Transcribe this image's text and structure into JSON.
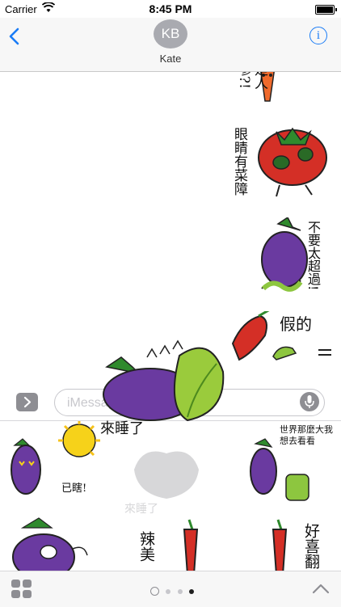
{
  "status_bar": {
    "carrier": "Carrier",
    "time": "8:45 PM"
  },
  "navbar": {
    "avatar_initials": "KB",
    "contact_name": "Kate"
  },
  "transcript": {
    "stickers": [
      {
        "name": "carrot",
        "caption": "是人參?!"
      },
      {
        "name": "tomato",
        "caption": "眼睛有菜障"
      },
      {
        "name": "eggplant-worm",
        "caption": "不要太超過!"
      },
      {
        "name": "chili",
        "caption": "假的"
      }
    ]
  },
  "compose": {
    "placeholder": "iMessage"
  },
  "drag_sticker": {
    "caption": "來睡了"
  },
  "drawer": {
    "stickers": [
      {
        "name": "eggplant-sun",
        "caption": "已瞎!"
      },
      {
        "name": "ghost-sleep",
        "caption": "來睡了"
      },
      {
        "name": "eggplant-luggage",
        "caption": "世界那麼大我想去看看"
      },
      {
        "name": "eggplant-smash",
        "caption": ""
      },
      {
        "name": "chili-hot",
        "caption": "辣美"
      },
      {
        "name": "chili-flip",
        "caption": "好喜翻"
      }
    ]
  },
  "page_dots": {
    "count": 3,
    "active_index": 2
  }
}
